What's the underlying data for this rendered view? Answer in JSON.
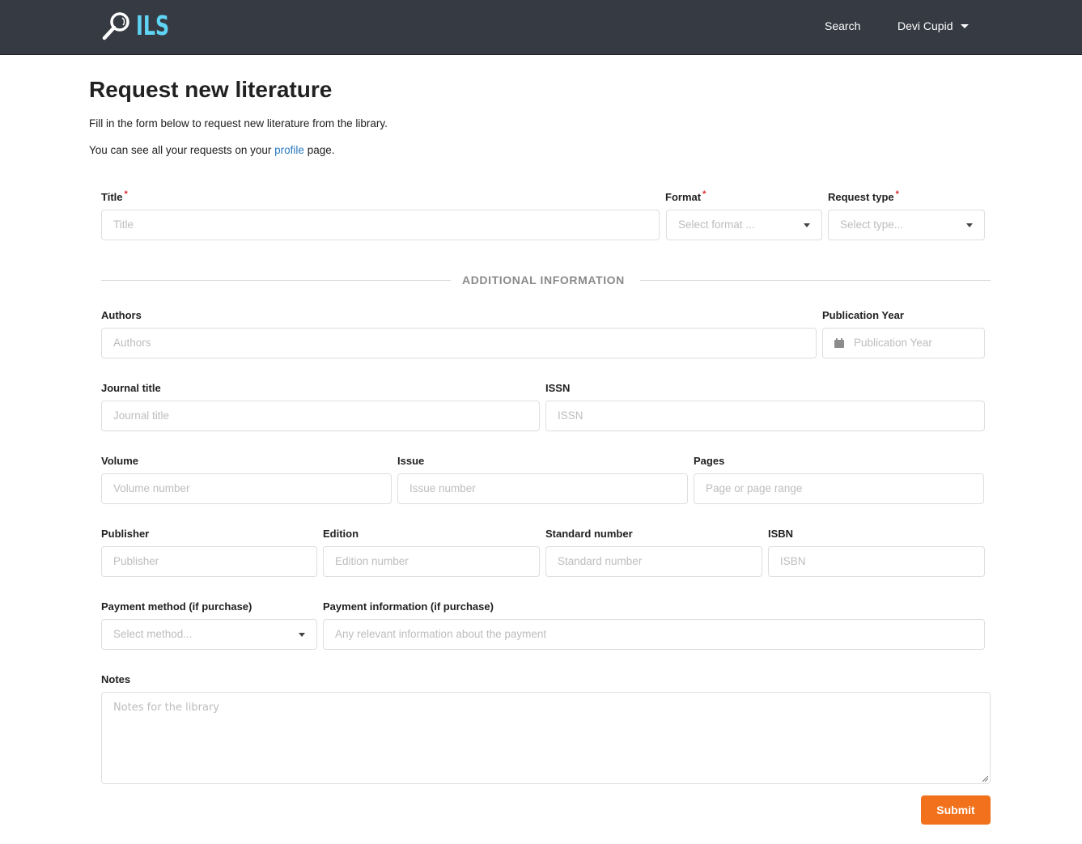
{
  "navbar": {
    "logo_text": "ILS",
    "search_link": "Search",
    "user_name": "Devi Cupid"
  },
  "page": {
    "title": "Request new literature",
    "intro_line1": "Fill in the form below to request new literature from the library.",
    "intro_line2_prefix": "You can see all your requests on your ",
    "intro_line2_link": "profile",
    "intro_line2_suffix": " page."
  },
  "form": {
    "title": {
      "label": "Title",
      "required_mark": "*",
      "placeholder": "Title"
    },
    "format": {
      "label": "Format",
      "required_mark": "*",
      "placeholder": "Select format ..."
    },
    "request_type": {
      "label": "Request type",
      "required_mark": "*",
      "placeholder": "Select type..."
    },
    "section_header": "ADDITIONAL INFORMATION",
    "authors": {
      "label": "Authors",
      "placeholder": "Authors"
    },
    "publication_year": {
      "label": "Publication Year",
      "placeholder": "Publication Year"
    },
    "journal_title": {
      "label": "Journal title",
      "placeholder": "Journal title"
    },
    "issn": {
      "label": "ISSN",
      "placeholder": "ISSN"
    },
    "volume": {
      "label": "Volume",
      "placeholder": "Volume number"
    },
    "issue": {
      "label": "Issue",
      "placeholder": "Issue number"
    },
    "pages": {
      "label": "Pages",
      "placeholder": "Page or page range"
    },
    "publisher": {
      "label": "Publisher",
      "placeholder": "Publisher"
    },
    "edition": {
      "label": "Edition",
      "placeholder": "Edition number"
    },
    "standard_number": {
      "label": "Standard number",
      "placeholder": "Standard number"
    },
    "isbn": {
      "label": "ISBN",
      "placeholder": "ISBN"
    },
    "payment_method": {
      "label": "Payment method (if purchase)",
      "placeholder": "Select method..."
    },
    "payment_info": {
      "label": "Payment information (if purchase)",
      "placeholder": "Any relevant information about the payment"
    },
    "notes": {
      "label": "Notes",
      "placeholder": "Notes for the library"
    },
    "submit_label": "Submit"
  },
  "colors": {
    "navbar_bg": "#363a43",
    "logo_accent": "#5fd4f4",
    "link": "#2a7ac0",
    "required": "#db2828",
    "submit_bg": "#f2711c"
  }
}
